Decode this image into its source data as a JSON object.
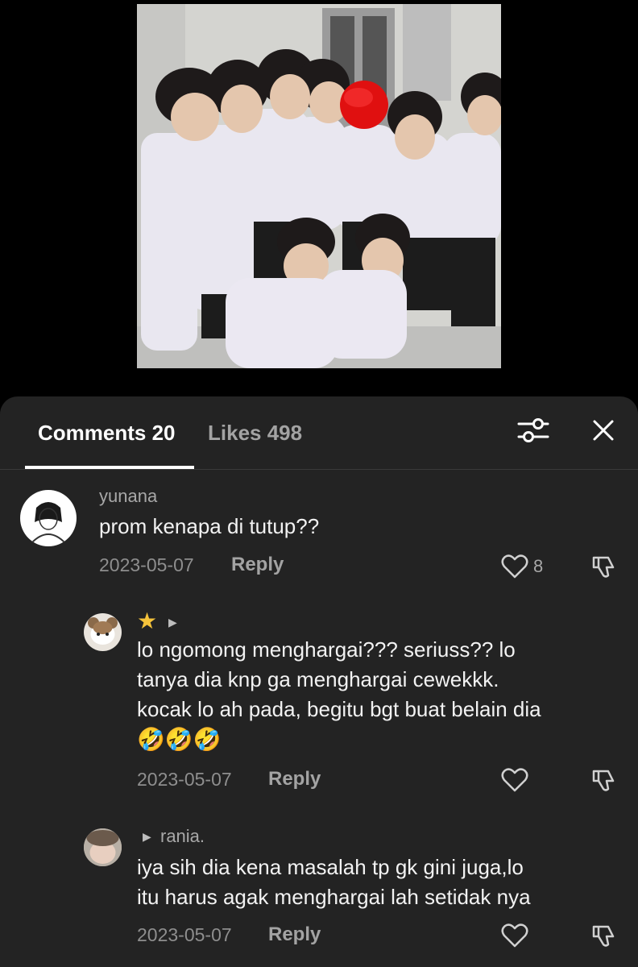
{
  "comments_panel": {
    "tabs": {
      "comments_label": "Comments 20",
      "likes_label": "Likes 498"
    }
  },
  "comments": [
    {
      "username": "yunana",
      "text": "prom kenapa di tutup??",
      "date": "2023-05-07",
      "reply_label": "Reply",
      "likes": "8"
    }
  ],
  "replies": [
    {
      "username": "",
      "text_lines": [
        "lo ngomong menghargai??? seriuss?? lo",
        "tanya dia knp ga menghargai cewekkk.",
        "kocak lo ah pada, begitu bgt buat belain dia"
      ],
      "emoji": "🤣🤣🤣",
      "date": "2023-05-07",
      "reply_label": "Reply"
    },
    {
      "username": "rania.",
      "text_lines": [
        "iya sih dia kena masalah tp gk gini juga,lo",
        "itu harus agak menghargai lah setidak nya"
      ],
      "date": "2023-05-07",
      "reply_label": "Reply"
    }
  ],
  "colors": {
    "panel_bg": "#232323",
    "accent_white": "#ffffff",
    "muted_text": "#a3a3a3",
    "censor_dot": "#e01010",
    "star": "#f5c33b"
  },
  "icons": [
    "filter-icon",
    "close-icon",
    "heart-icon",
    "dislike-icon",
    "star-icon",
    "caret-right-icon"
  ]
}
